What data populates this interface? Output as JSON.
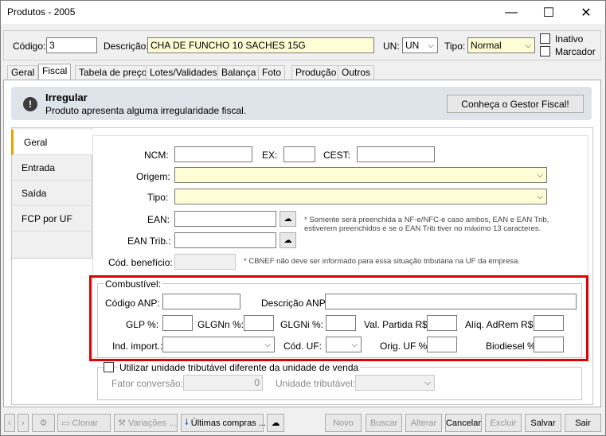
{
  "window": {
    "title": "Produtos - 2005",
    "minimize": "—",
    "maximize": "☐",
    "close": "✕"
  },
  "header": {
    "codigo_label": "Código:",
    "codigo_value": "3",
    "descricao_label": "Descrição:",
    "descricao_value": "CHA DE FUNCHO 10 SACHES 15G",
    "un_label": "UN:",
    "un_value": "UN",
    "tipo_label": "Tipo:",
    "tipo_value": "Normal",
    "inativo_label": "Inativo",
    "marcador_label": "Marcador"
  },
  "tabs": [
    "Geral",
    "Fiscal",
    "Tabela de preço",
    "Lotes/Validades",
    "Balança",
    "Foto",
    "Produção",
    "Outros"
  ],
  "active_tab": "Fiscal",
  "banner": {
    "title": "Irregular",
    "message": "Produto apresenta alguma irregularidade fiscal.",
    "button": "Conheça o Gestor Fiscal!",
    "icon": "exclamation-icon"
  },
  "side_tabs": [
    "Geral",
    "Entrada",
    "Saída",
    "FCP por UF"
  ],
  "form": {
    "ncm_label": "NCM:",
    "ex_label": "EX:",
    "cest_label": "CEST:",
    "origem_label": "Origem:",
    "tipo_label": "Tipo:",
    "ean_label": "EAN:",
    "ean_trib_label": "EAN Trib.:",
    "ean_note": "* Somente será preenchida a NF-e/NFC-e caso ambos, EAN e EAN Trib, estiverem preenchidos e se o EAN Trib tiver no máximo 13 caracteres.",
    "cod_benef_label": "Cód. benefício:",
    "cod_benef_note": "* CBNEF não deve ser informado para essa situação tributária na UF da empresa."
  },
  "combustivel": {
    "legend": "Combustível:",
    "codigo_anp": "Código ANP:",
    "descricao_anp": "Descrição ANP:",
    "glp": "GLP %:",
    "glgnn": "GLGNn %:",
    "glgni": "GLGNi %:",
    "val_partida": "Val. Partida R$:",
    "aliq_adrem": "Alíq. AdRem R$:",
    "ind_import": "Ind. import.:",
    "cod_uf": "Cód. UF:",
    "orig_uf": "Orig. UF %:",
    "biodiesel": "Biodiesel %:"
  },
  "unidade_trib": {
    "checkbox_label": "Utilizar unidade tributável diferente da unidade de venda",
    "fator_label": "Fator conversão:",
    "fator_value": "0",
    "unidade_label": "Unidade tributável:"
  },
  "toolbar": {
    "clonar": "Clonar",
    "variacoes": "Variações ...",
    "ultimas": "Últimas compras ...",
    "novo": "Novo",
    "buscar": "Buscar",
    "alterar": "Alterar",
    "cancelar": "Cancelar",
    "excluir": "Excluir",
    "salvar": "Salvar",
    "sair": "Sair"
  },
  "colors": {
    "highlight": "#e00000",
    "yellow_field": "#fefdd6",
    "banner_bg": "#dfe3ea"
  }
}
